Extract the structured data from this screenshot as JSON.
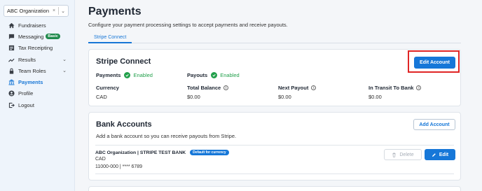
{
  "sidebar": {
    "org_select": {
      "value": "ABC Organization",
      "clear": "×",
      "chevron": "⌄"
    },
    "items": [
      {
        "label": "Fundraisers",
        "icon": "home-icon",
        "active": false
      },
      {
        "label": "Messaging",
        "icon": "chat-icon",
        "badge": "Basic",
        "active": false
      },
      {
        "label": "Tax Receipting",
        "icon": "receipt-icon",
        "active": false
      },
      {
        "label": "Results",
        "icon": "trend-icon",
        "chevron": "⌄",
        "active": false
      },
      {
        "label": "Team Roles",
        "icon": "lock-icon",
        "chevron": "⌄",
        "active": false
      },
      {
        "label": "Payments",
        "icon": "bank-icon",
        "active": true
      },
      {
        "label": "Profile",
        "icon": "user-icon",
        "active": false
      },
      {
        "label": "Logout",
        "icon": "logout-icon",
        "active": false
      }
    ]
  },
  "main": {
    "title": "Payments",
    "subtitle": "Configure your payment processing settings to accept payments and receive payouts.",
    "tabs": [
      {
        "label": "Stripe Connect",
        "active": true
      }
    ]
  },
  "stripe_card": {
    "title": "Stripe Connect",
    "edit_button": "Edit Account",
    "payments_label": "Payments",
    "payments_status": "Enabled",
    "payouts_label": "Payouts",
    "payouts_status": "Enabled",
    "columns": [
      {
        "head": "Currency",
        "value": "CAD",
        "info": false
      },
      {
        "head": "Total Balance",
        "value": "$0.00",
        "info": true
      },
      {
        "head": "Next Payout",
        "value": "$0.00",
        "info": true
      },
      {
        "head": "In Transit To Bank",
        "value": "$0.00",
        "info": true
      }
    ]
  },
  "bank_card": {
    "title": "Bank Accounts",
    "subtitle": "Add a bank account so you can receive payouts from Stripe.",
    "add_button": "Add Account",
    "accounts": [
      {
        "name": "ABC Organization | STRIPE TEST BANK",
        "pill": "Default for currency",
        "currency": "CAD",
        "number": "11000-000 | **** 6789",
        "delete_label": "Delete",
        "edit_label": "Edit"
      }
    ]
  },
  "colors": {
    "accent": "#1677d8",
    "success": "#22a04b",
    "highlight": "#e02525",
    "sidebar_bg": "#eef4fb",
    "badge": "#1f8a4c"
  }
}
